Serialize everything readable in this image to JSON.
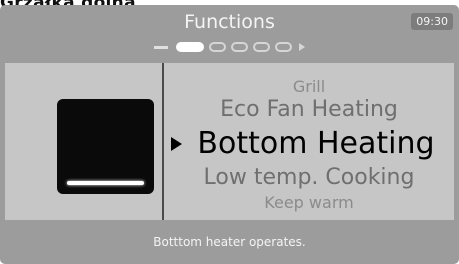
{
  "page_heading": "Grzałka dolna",
  "header": {
    "title": "Functions",
    "clock": "09:30"
  },
  "pager": {
    "total_pages": 5,
    "active_page": 1
  },
  "menu": {
    "items": [
      {
        "label": "Grill"
      },
      {
        "label": "Eco Fan Heating"
      },
      {
        "label": "Bottom Heating",
        "selected": true
      },
      {
        "label": "Low temp. Cooking"
      },
      {
        "label": "Keep warm"
      }
    ]
  },
  "preview": {
    "icon": "bottom-heater-icon"
  },
  "status": {
    "message": "Botttom heater operates."
  },
  "colors": {
    "screen": "#9c9c9c",
    "panel": "#c6c6c6",
    "selected_text": "#000000",
    "faded_text": "#6f6f6f"
  }
}
